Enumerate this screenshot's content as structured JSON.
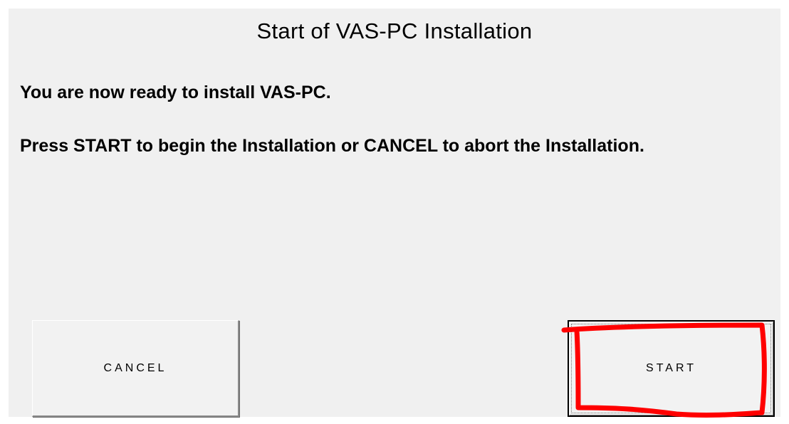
{
  "dialog": {
    "title": "Start of VAS-PC Installation",
    "message_ready": "You are now ready to install VAS-PC.",
    "message_instructions": "Press START to begin the Installation or CANCEL to abort the Installation."
  },
  "buttons": {
    "cancel_label": "CANCEL",
    "start_label": "START"
  },
  "colors": {
    "background": "#f0f0f0",
    "highlight": "#ff0000"
  }
}
